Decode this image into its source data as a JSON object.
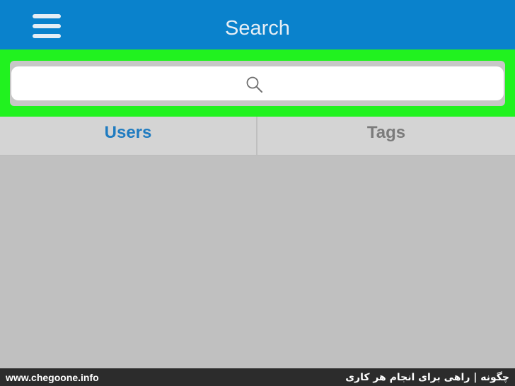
{
  "header": {
    "title": "Search",
    "menu_icon": "hamburger-menu-icon",
    "background_color": "#0a82cc"
  },
  "search": {
    "placeholder": "",
    "value": "",
    "icon": "search-icon",
    "highlight_color": "#21f21f"
  },
  "tabs": [
    {
      "label": "Users",
      "active": true,
      "color": "#1f7bc0"
    },
    {
      "label": "Tags",
      "active": false,
      "color": "#7b7b7b"
    }
  ],
  "footer": {
    "url": "www.chegoone.info",
    "tagline": "چگونه | راهی برای انجام هر کاری"
  }
}
